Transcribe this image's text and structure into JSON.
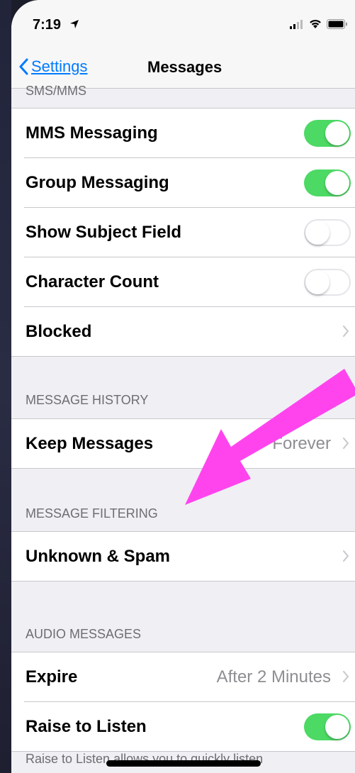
{
  "status_bar": {
    "time": "7:19"
  },
  "nav": {
    "back_label": "Settings",
    "title": "Messages"
  },
  "sections": {
    "sms_header": "SMS/MMS",
    "sms_rows": [
      {
        "label": "MMS Messaging",
        "toggle": "on"
      },
      {
        "label": "Group Messaging",
        "toggle": "on"
      },
      {
        "label": "Show Subject Field",
        "toggle": "off"
      },
      {
        "label": "Character Count",
        "toggle": "off"
      },
      {
        "label": "Blocked"
      }
    ],
    "history_header": "MESSAGE HISTORY",
    "history_rows": [
      {
        "label": "Keep Messages",
        "value": "Forever"
      }
    ],
    "filtering_header": "MESSAGE FILTERING",
    "filtering_rows": [
      {
        "label": "Unknown & Spam"
      }
    ],
    "audio_header": "AUDIO MESSAGES",
    "audio_rows": [
      {
        "label": "Expire",
        "value": "After 2 Minutes"
      },
      {
        "label": "Raise to Listen",
        "toggle": "on"
      }
    ],
    "audio_footer": "Raise to Listen allows you to quickly listen"
  },
  "colors": {
    "accent": "#007aff",
    "toggle_on": "#4cd964",
    "annotation_arrow": "#ff44ee"
  }
}
